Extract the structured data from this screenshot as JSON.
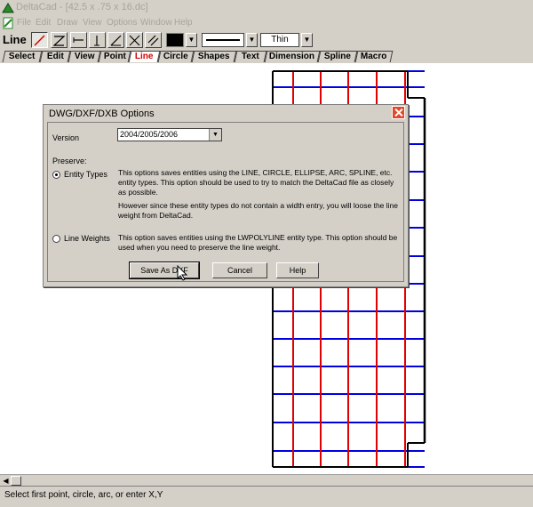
{
  "window": {
    "title": "DeltaCad - [42.5 x .75 x 16.dc]"
  },
  "menu": {
    "items": [
      "File",
      "Edit",
      "Draw",
      "View",
      "Options",
      "Window",
      "Help"
    ]
  },
  "toolbar": {
    "mode_label": "Line",
    "thickness": "Thin",
    "color": "#000000"
  },
  "tabs": [
    "Select",
    "Edit",
    "View",
    "Point",
    "Line",
    "Circle",
    "Shapes",
    "Text",
    "Dimension",
    "Spline",
    "Macro"
  ],
  "active_tab": "Line",
  "dialog": {
    "title": "DWG/DXF/DXB Options",
    "version_label": "Version",
    "version_value": "2004/2005/2006",
    "preserve_label": "Preserve:",
    "entity_types": {
      "label": "Entity Types",
      "selected": true,
      "desc1": "This options saves entities using the LINE, CIRCLE, ELLIPSE, ARC, SPLINE, etc. entity types.  This option should be used to try to match the DeltaCad file as closely as possible.",
      "desc2": "However since these entity types do not contain a width entry, you will loose the line weight from DeltaCad."
    },
    "line_weights": {
      "label": "Line Weights",
      "selected": false,
      "desc": "This option saves entities using the LWPOLYLINE entity type.  This option should be used when you need to preserve the line weight."
    },
    "buttons": {
      "save": "Save As DXF",
      "cancel": "Cancel",
      "help": "Help"
    }
  },
  "status": {
    "text": "Select first point, circle, arc, or enter X,Y"
  },
  "colors": {
    "grid_red": "#e00000",
    "grid_blue": "#0000e0",
    "chrome": "#d4d0c8"
  }
}
